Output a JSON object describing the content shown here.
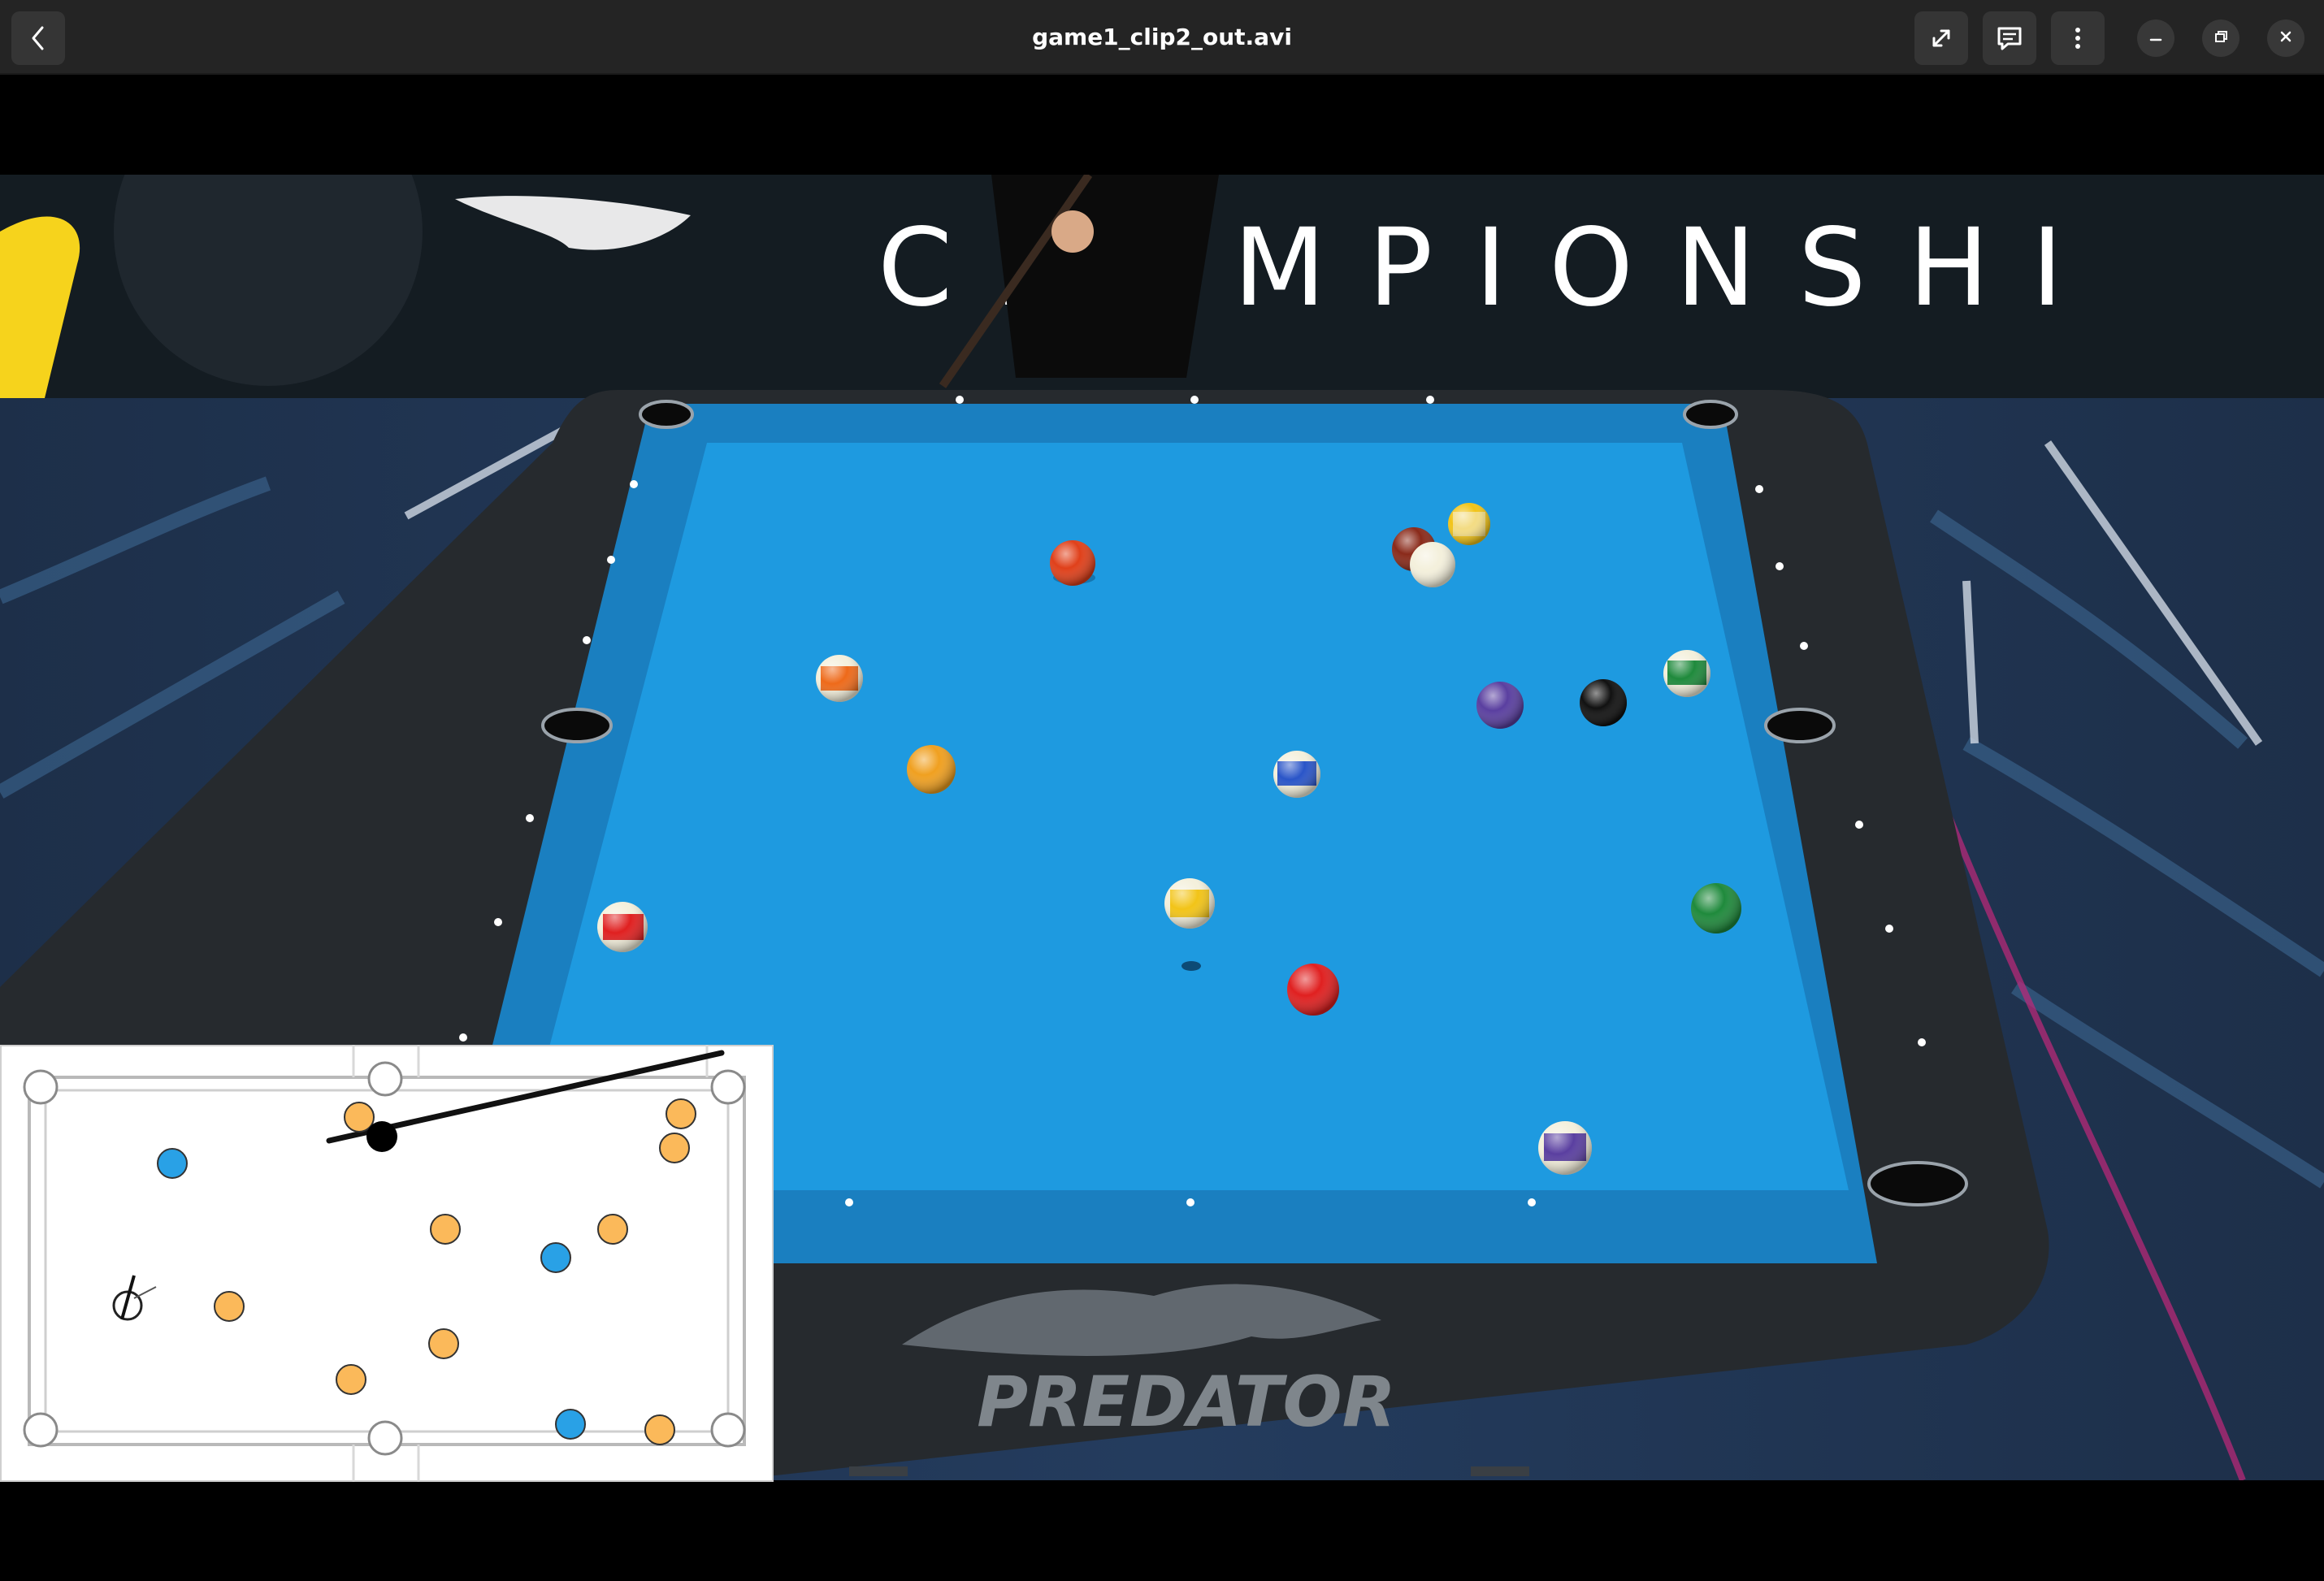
{
  "window": {
    "title": "game1_clip2_out.avi"
  },
  "header": {
    "back_icon": "chevron-left-icon",
    "fullscreen_icon": "expand-icon",
    "subtitles_icon": "subtitles-icon",
    "menu_icon": "vertical-ellipsis-icon",
    "minimize_icon": "minimize-icon",
    "maximize_icon": "restore-icon",
    "close_icon": "close-icon"
  },
  "video": {
    "banner_text": "CHAMPIONSHI",
    "table_brand": "PREDATOR",
    "cloth_color": "#1e9ae0",
    "ball_colors": {
      "red": "#e02020",
      "orange": "#f0a020",
      "purple": "#5a3fa0",
      "black": "#111111",
      "green": "#1f8a3c",
      "blue": "#2a55c8",
      "maroon": "#8a2a1a",
      "yellow": "#f2c418",
      "cue": "#f4f0dc"
    }
  },
  "minimap": {
    "ball_colors": {
      "object": "#fbb95a",
      "highlight": "#29a1e6",
      "eight": "#000000"
    }
  }
}
